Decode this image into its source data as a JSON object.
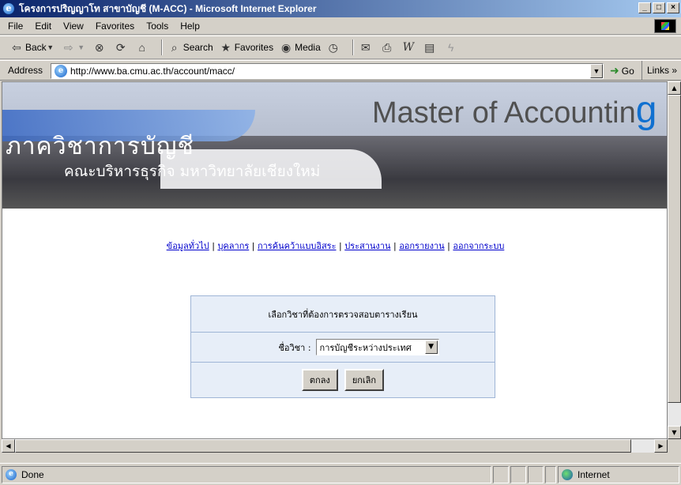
{
  "window": {
    "title": "โครงการปริญญาโท สาขาบัญชี (M-ACC) - Microsoft Internet Explorer",
    "controls": {
      "minimize": "_",
      "maximize": "□",
      "close": "×"
    }
  },
  "menu": [
    "File",
    "Edit",
    "View",
    "Favorites",
    "Tools",
    "Help"
  ],
  "toolbar": {
    "back": "Back",
    "search": "Search",
    "favorites": "Favorites",
    "media": "Media"
  },
  "address": {
    "label": "Address",
    "url": "http://www.ba.cmu.ac.th/account/macc/",
    "go": "Go",
    "links": "Links »"
  },
  "banner": {
    "dept": "ภาควิชาการบัญชี",
    "faculty": "คณะบริหารธุรกิจ มหาวิทยาลัยเชียงใหม่",
    "master_main": "Master of Accountin",
    "master_tail": "g"
  },
  "nav": [
    "ข้อมูลทั่วไป",
    "บุคลากร",
    "การค้นคว้าแบบอิสระ",
    "ประสานงาน",
    "ออกรายงาน",
    "ออกจากระบบ"
  ],
  "form": {
    "heading": "เลือกวิชาที่ต้องการตรวจสอบตารางเรียน",
    "course_label": "ชื่อวิชา :",
    "course_value": "การบัญชีระหว่างประเทศ",
    "ok": "ตกลง",
    "cancel": "ยกเลิก"
  },
  "status": {
    "text": "Done",
    "zone": "Internet"
  },
  "icons": {
    "ie": "ie-logo-icon",
    "back": "back-arrow-icon",
    "forward": "forward-arrow-icon",
    "stop": "stop-icon",
    "refresh": "refresh-icon",
    "home": "home-icon",
    "search": "search-icon",
    "favorites": "favorites-icon",
    "media": "media-icon",
    "history": "history-icon",
    "mail": "mail-icon",
    "print": "print-icon"
  }
}
